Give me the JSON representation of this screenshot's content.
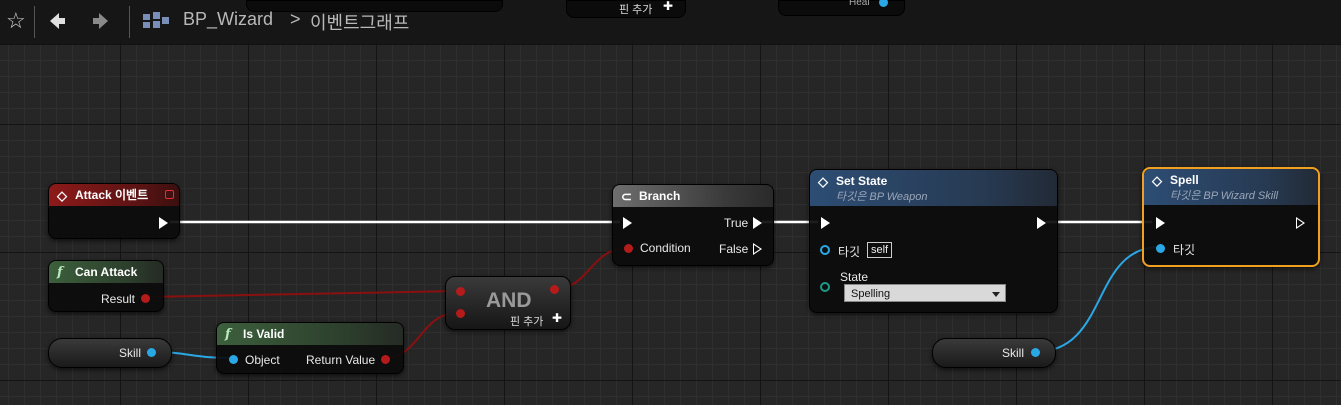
{
  "toolbar": {
    "blueprint_name": "BP_Wizard",
    "separator": ">",
    "graph_name": "이벤트그래프"
  },
  "background_nodes": {
    "add_pin_label": "핀 추가",
    "heal_label": "Heal"
  },
  "nodes": {
    "attack_event": {
      "title": "Attack 이벤트"
    },
    "can_attack": {
      "title": "Can Attack",
      "output_label": "Result"
    },
    "skill_var_1": {
      "label": "Skill"
    },
    "is_valid": {
      "title": "Is Valid",
      "input_label": "Object",
      "output_label": "Return Value"
    },
    "and_node": {
      "title": "AND",
      "add_pin_label": "핀 추가"
    },
    "branch": {
      "title": "Branch",
      "condition_label": "Condition",
      "true_label": "True",
      "false_label": "False"
    },
    "set_state": {
      "title": "Set State",
      "subtitle": "타깃은 BP Weapon",
      "target_label": "타깃",
      "target_value": "self",
      "state_label": "State",
      "state_value": "Spelling"
    },
    "spell": {
      "title": "Spell",
      "subtitle": "타깃은 BP Wizard Skill",
      "target_label": "타깃"
    },
    "skill_var_2": {
      "label": "Skill"
    }
  },
  "colors": {
    "exec_wire": "#ffffff",
    "bool_wire": "#8a1010",
    "object_wire": "#2aa8e6",
    "selected_outline": "#f0a020"
  }
}
